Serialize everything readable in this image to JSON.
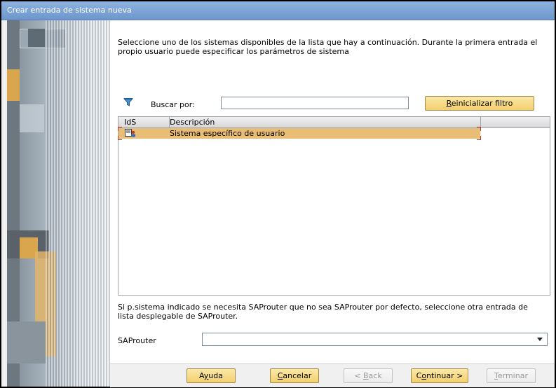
{
  "window": {
    "title": "Crear entrada de sistema nueva"
  },
  "intro_text": "Seleccione uno de los sistemas disponibles de la lista que hay a continuación. Durante la primera entrada el propio usuario puede especificar los parámetros de sistema",
  "search": {
    "label": "Buscar por:",
    "value": "",
    "reset_label": "Reinicializar filtro",
    "reset_mnemonic": "R",
    "reset_rest": "einicializar filtro"
  },
  "table": {
    "columns": [
      "IdS",
      "Descripción"
    ],
    "rows": [
      {
        "id": "",
        "description": "Sistema específico de usuario",
        "selected": true
      }
    ]
  },
  "saprouter": {
    "note": "Si p.sistema indicado se necesita SAProuter que no sea SAProuter por defecto, seleccione otra entrada de lista desplegable de SAProuter.",
    "label": "SAProuter",
    "value": ""
  },
  "footer": {
    "help": {
      "pre": "A",
      "key": "y",
      "post": "uda"
    },
    "cancel": {
      "pre": "",
      "key": "C",
      "post": "ancelar"
    },
    "back": {
      "pre": "< ",
      "key": "B",
      "post": "ack"
    },
    "next": {
      "pre": "C",
      "key": "o",
      "post": "ntinuar >"
    },
    "finish": {
      "pre": "",
      "key": "T",
      "post": "erminar"
    }
  },
  "colors": {
    "accent": "#f4cf6d",
    "selection": "#e9bd73",
    "titlebar": "#7ea5d6"
  },
  "icons": {
    "filter": "funnel-filter-icon",
    "system": "system-entry-icon",
    "dropdown": "chevron-down-icon"
  }
}
